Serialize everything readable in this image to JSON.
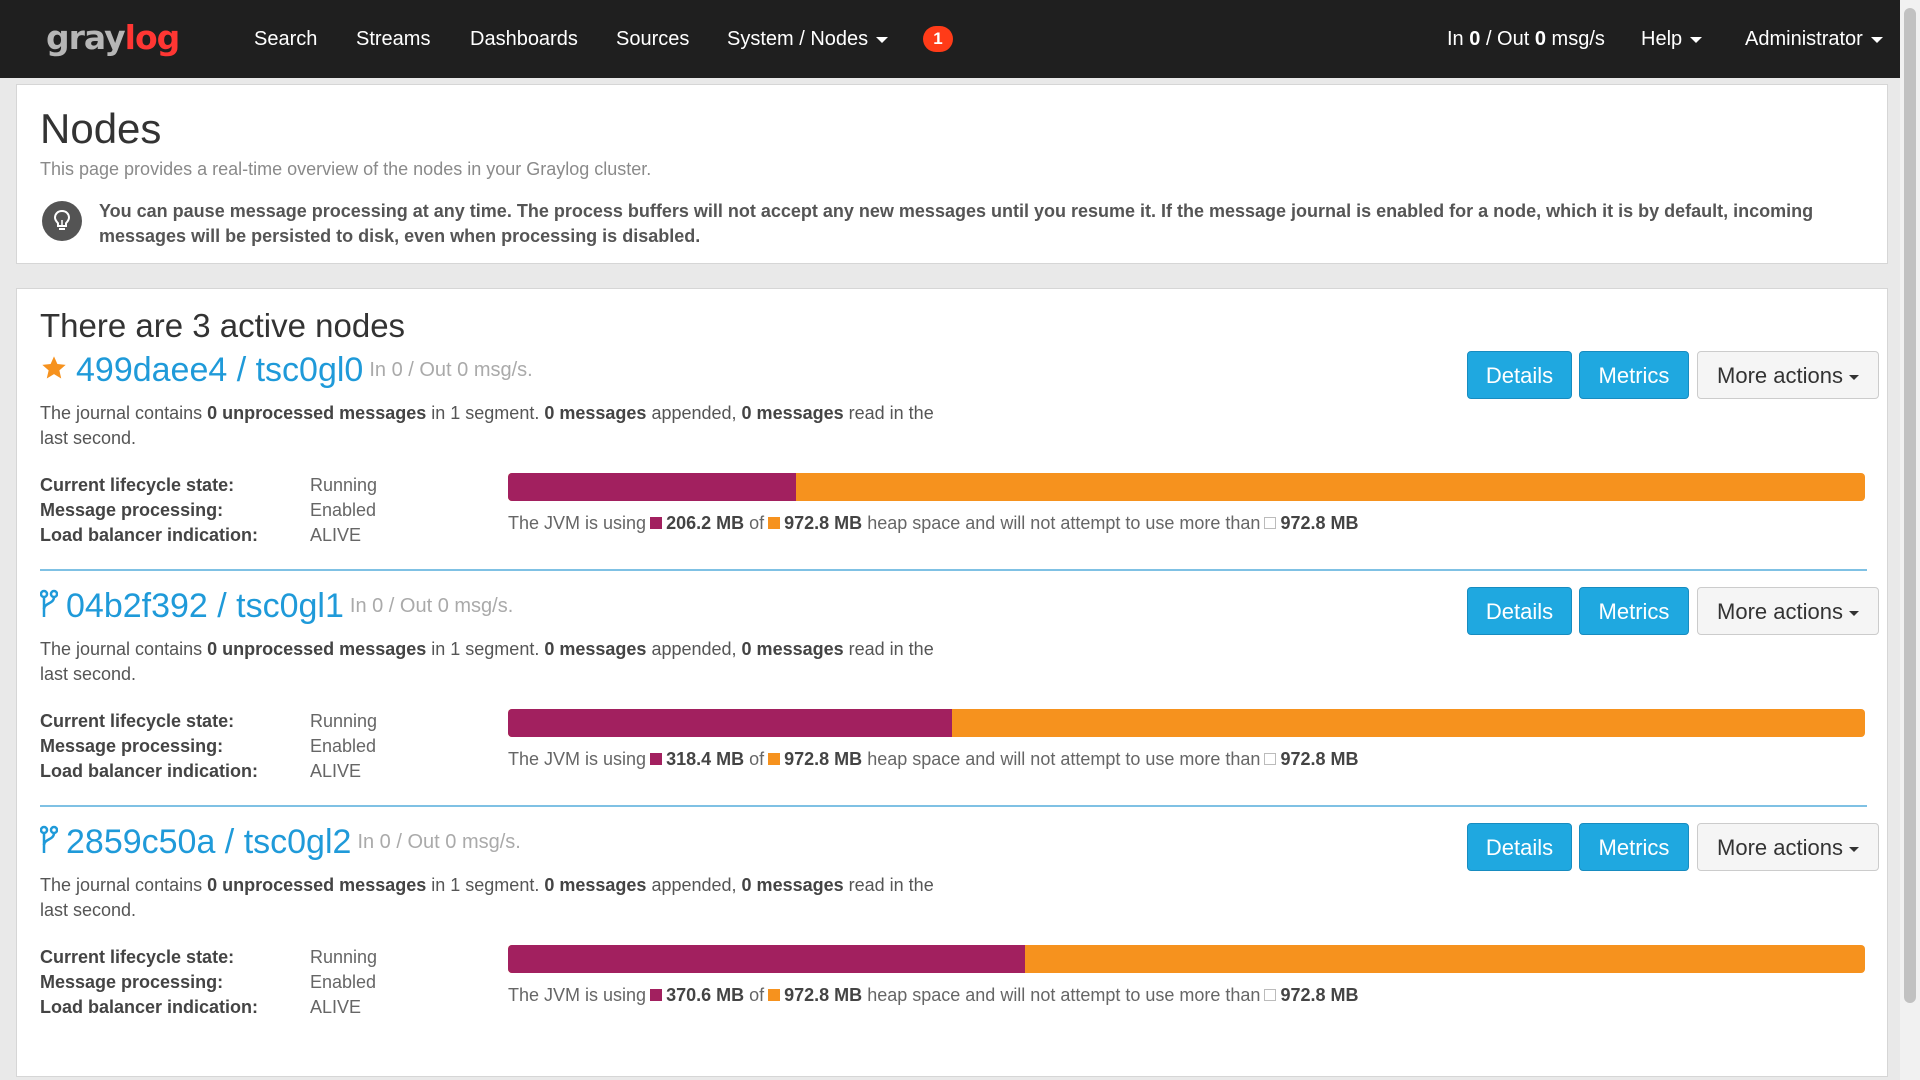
{
  "navbar": {
    "brand": {
      "part1": "gray",
      "part2": "log"
    },
    "items": [
      {
        "label": "Search"
      },
      {
        "label": "Streams"
      },
      {
        "label": "Dashboards"
      },
      {
        "label": "Sources"
      },
      {
        "label": "System / Nodes"
      }
    ],
    "notification_count": "1",
    "throughput": {
      "in_label": "In",
      "in_value": "0",
      "sep": "/ Out",
      "out_value": "0",
      "unit": "msg/s"
    },
    "help_label": "Help",
    "user_label": "Administrator"
  },
  "header": {
    "title": "Nodes",
    "description": "This page provides a real-time overview of the nodes in your Graylog cluster.",
    "info": "You can pause message processing at any time. The process buffers will not accept any new messages until you resume it. If the message journal is enabled for a node, which it is by default, incoming messages will be persisted to disk, even when processing is disabled."
  },
  "nodes_section": {
    "title": "There are 3 active nodes",
    "buttons": {
      "details": "Details",
      "metrics": "Metrics",
      "more": "More actions"
    },
    "labels": {
      "lifecycle": "Current lifecycle state:",
      "processing": "Message processing:",
      "lb": "Load balancer indication:",
      "journal_prefix": "The journal contains",
      "journal_unprocessed": "0 unprocessed messages",
      "journal_mid1": "in 1 segment.",
      "journal_appended": "0 messages",
      "journal_mid2": "appended,",
      "journal_read": "0 messages",
      "journal_suffix": "read in the last second.",
      "heap_prefix": "The JVM is using",
      "heap_of": "of",
      "heap_mid": "heap space and will not attempt to use more than"
    },
    "nodes": [
      {
        "name": "499daee4 / tsc0gl0",
        "icon": "star-icon",
        "master": true,
        "rate": "In 0 / Out 0 msg/s.",
        "lifecycle": "Running",
        "processing": "Enabled",
        "lb": "ALIVE",
        "heap_used": "206.2 MB",
        "heap_total": "972.8 MB",
        "heap_max": "972.8 MB",
        "heap_used_fraction": 0.212
      },
      {
        "name": "04b2f392 / tsc0gl1",
        "icon": "code-fork-icon",
        "master": false,
        "rate": "In 0 / Out 0 msg/s.",
        "lifecycle": "Running",
        "processing": "Enabled",
        "lb": "ALIVE",
        "heap_used": "318.4 MB",
        "heap_total": "972.8 MB",
        "heap_max": "972.8 MB",
        "heap_used_fraction": 0.327
      },
      {
        "name": "2859c50a / tsc0gl2",
        "icon": "code-fork-icon",
        "master": false,
        "rate": "In 0 / Out 0 msg/s.",
        "lifecycle": "Running",
        "processing": "Enabled",
        "lb": "ALIVE",
        "heap_used": "370.6 MB",
        "heap_total": "972.8 MB",
        "heap_max": "972.8 MB",
        "heap_used_fraction": 0.381
      }
    ]
  },
  "colors": {
    "navbar_bg": "#1f1f1f",
    "link": "#1f9ad9",
    "primary_button": "#1fa8e0",
    "heap_used": "#a2205f",
    "heap_total": "#f6921e",
    "badge": "#ff3b18"
  }
}
